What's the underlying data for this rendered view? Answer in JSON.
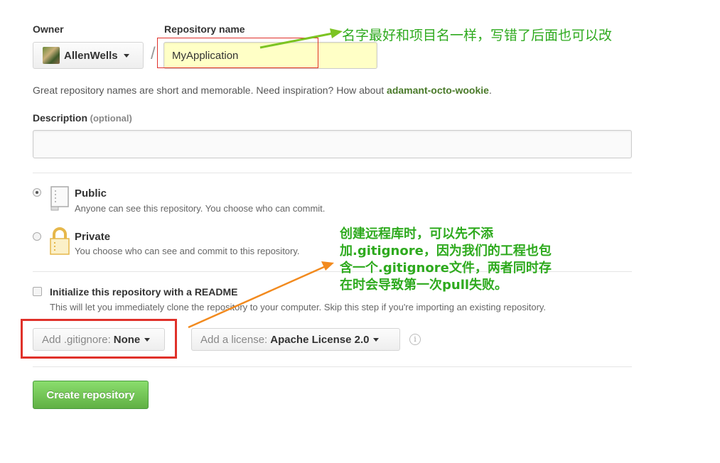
{
  "owner": {
    "label": "Owner",
    "name": "AllenWells"
  },
  "repository": {
    "label": "Repository name",
    "value": "MyApplication",
    "separator": "/"
  },
  "annotations": {
    "name_note": "名字最好和项目名一样，写错了后面也可以改",
    "gitignore_note_lines": [
      "创建远程库时，可以先不添",
      "加.gitignore，因为我们的工程也包",
      "含一个.gitignore文件，两者同时存",
      "在时会导致第一次pull失败。"
    ]
  },
  "hint": {
    "prefix": "Great repository names are short and memorable. Need inspiration? How about ",
    "suggestion": "adamant-octo-wookie",
    "suffix": "."
  },
  "description": {
    "label": "Description",
    "optional": "(optional)",
    "value": ""
  },
  "visibility": {
    "public": {
      "title": "Public",
      "subtitle": "Anyone can see this repository. You choose who can commit.",
      "selected": true
    },
    "private": {
      "title": "Private",
      "subtitle": "You choose who can see and commit to this repository.",
      "selected": false
    }
  },
  "readme": {
    "label": "Initialize this repository with a README",
    "subtitle": "This will let you immediately clone the repository to your computer. Skip this step if you're importing an existing repository.",
    "checked": false
  },
  "gitignore": {
    "prefix": "Add .gitignore:",
    "value": "None"
  },
  "license": {
    "prefix": "Add a license:",
    "value": "Apache License 2.0",
    "info_icon": "i"
  },
  "create_button": "Create repository",
  "colors": {
    "annotation_green": "#2eaa1e",
    "highlight_red": "#e0312a",
    "arrow_orange": "#f28a1e",
    "button_green": "#60b044"
  }
}
